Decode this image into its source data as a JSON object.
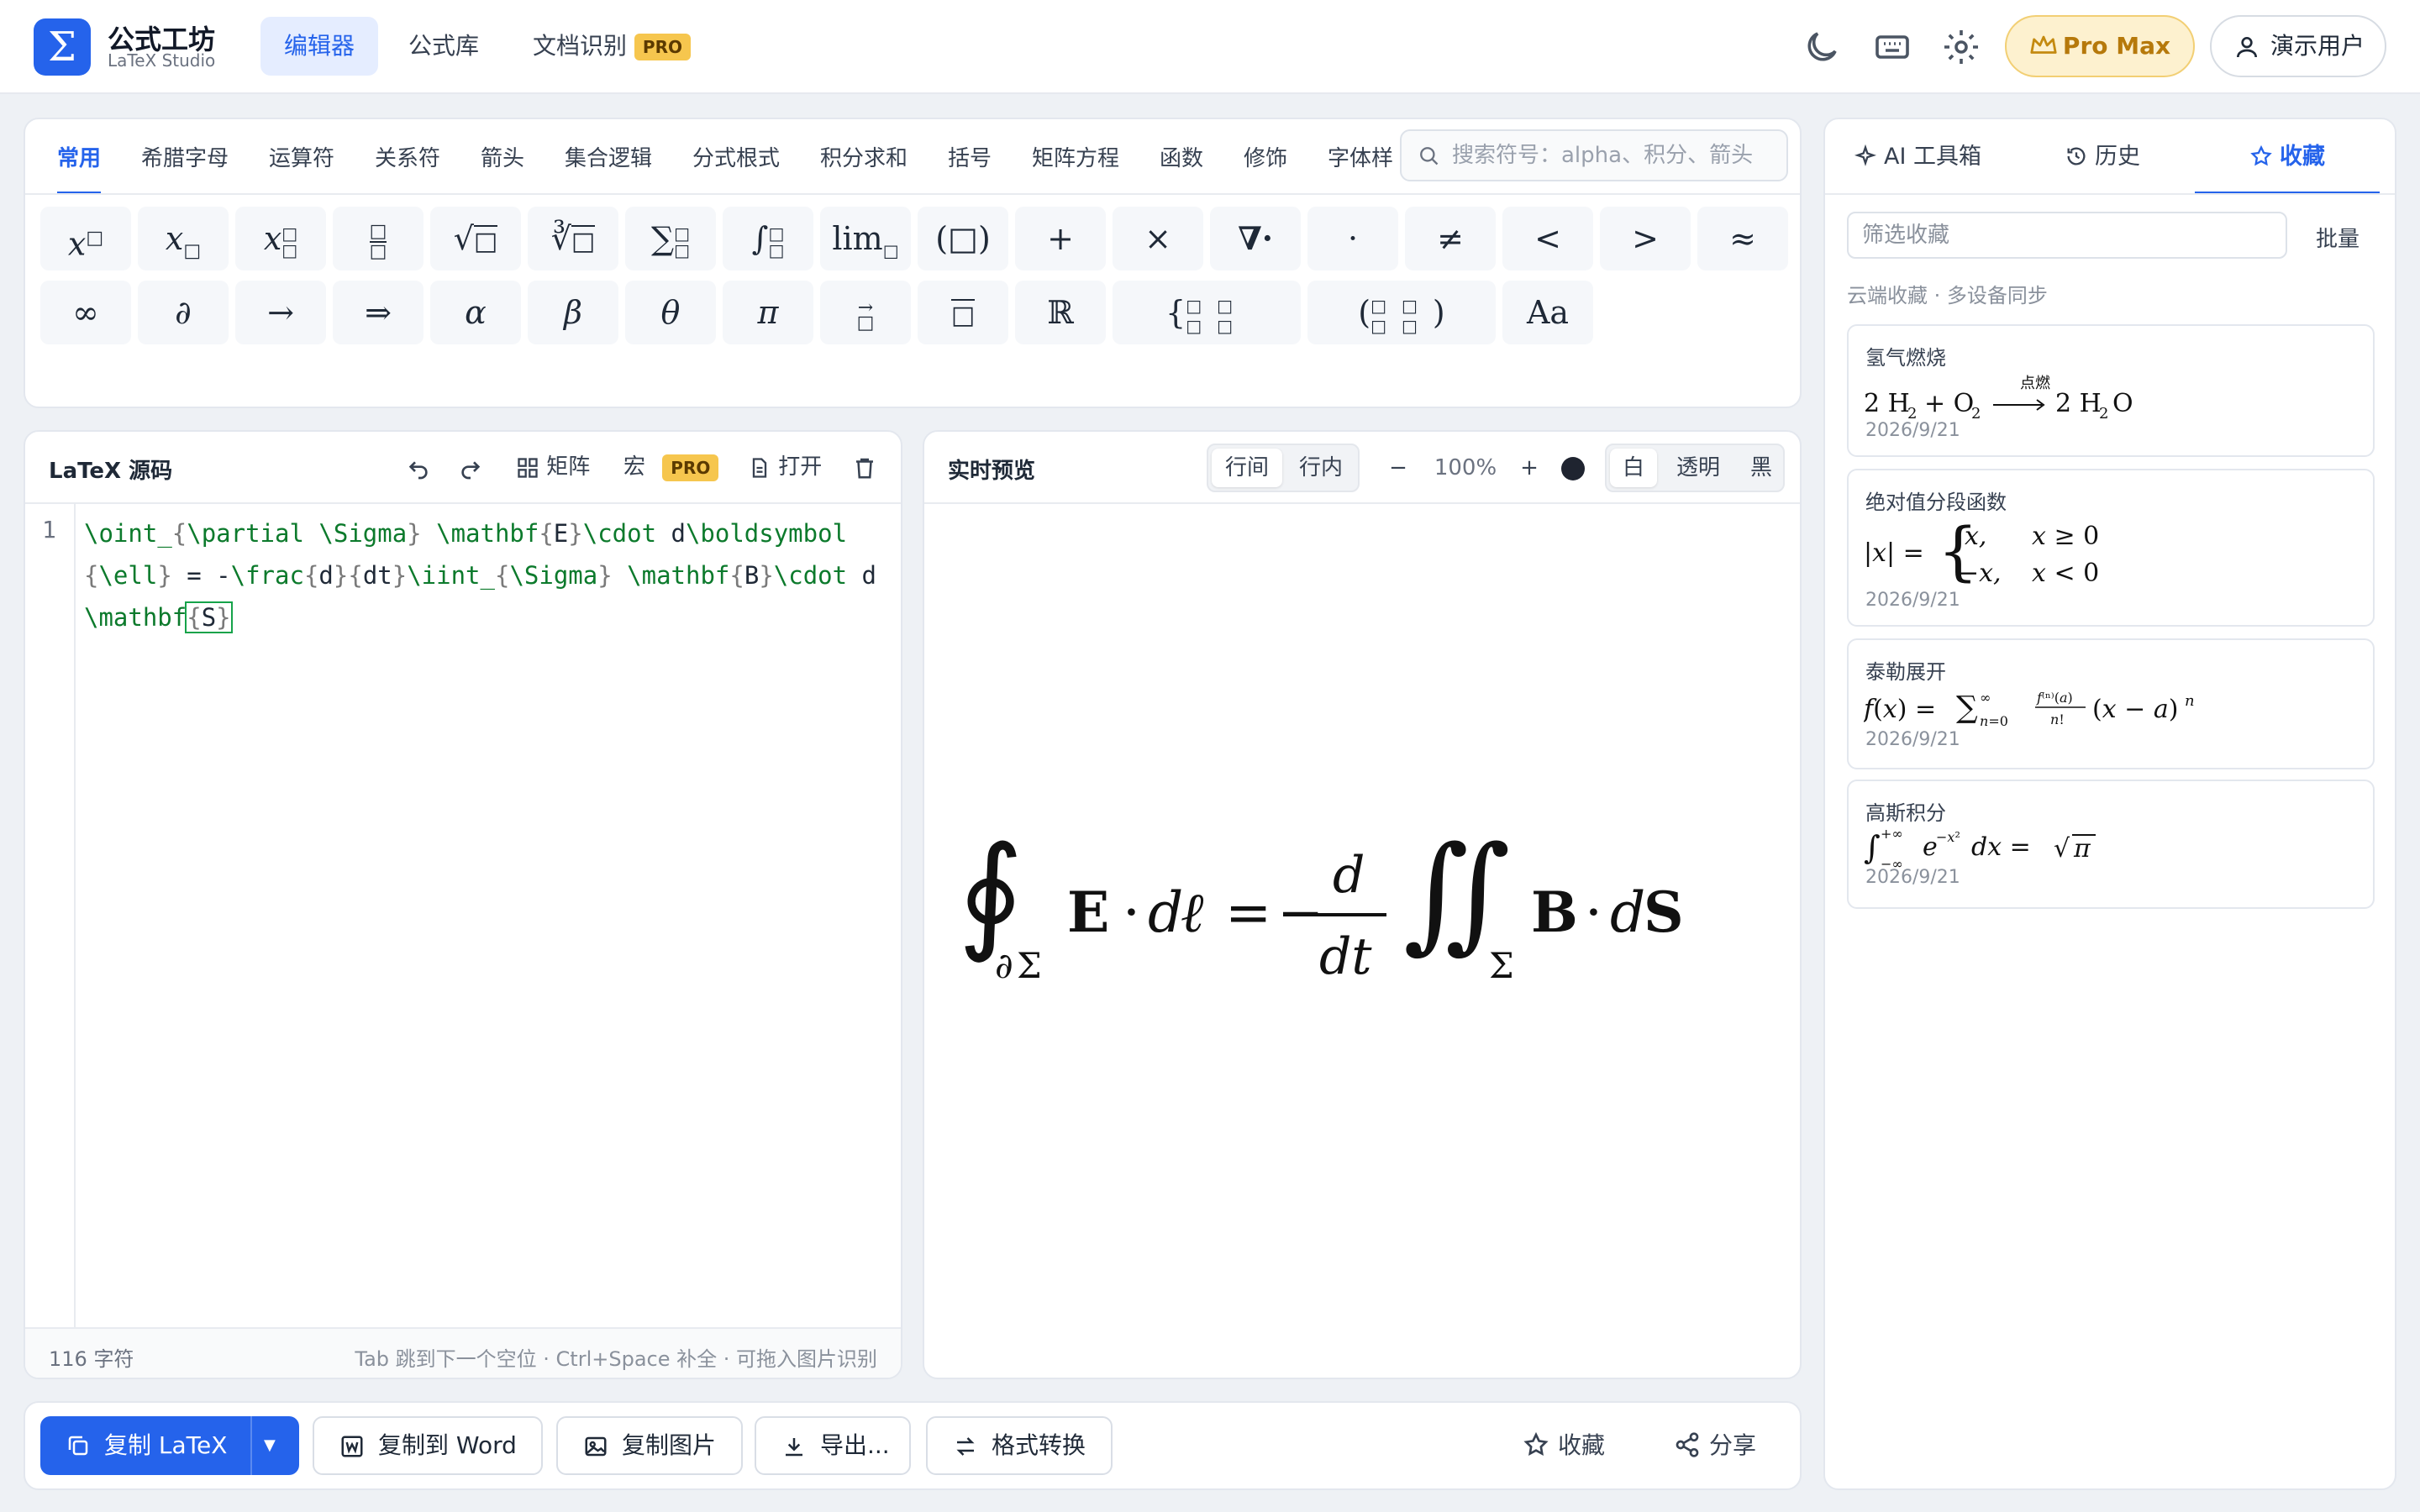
{
  "app": {
    "name": "公式工坊",
    "subtitle": "LaTeX Studio",
    "logo_glyph": "Σ",
    "accent": "#2563eb"
  },
  "nav": {
    "items": [
      {
        "label": "编辑器",
        "active": true
      },
      {
        "label": "公式库"
      },
      {
        "label": "文档识别",
        "badge": "PRO"
      }
    ]
  },
  "top_right": {
    "icons": [
      "moon-icon",
      "keyboard-icon",
      "gear-icon"
    ],
    "promax_label": "Pro Max",
    "user_label": "演示用户"
  },
  "palette": {
    "categories": [
      "常用",
      "希腊字母",
      "运算符",
      "关系符",
      "箭头",
      "集合逻辑",
      "分式根式",
      "积分求和",
      "括号",
      "矩阵方程",
      "函数",
      "修饰",
      "字体样"
    ],
    "active_category": "常用",
    "search_placeholder": "搜索符号：alpha、积分、箭头",
    "row1": [
      "x□",
      "x□",
      "x□□",
      "□/□",
      "√□",
      "∛□",
      "∑□□",
      "∫□□",
      "lim□",
      "(□)",
      "+",
      "×",
      "∇·",
      "·",
      "≠",
      "<",
      ">",
      "≈"
    ],
    "row2": [
      "∞",
      "∂",
      "→",
      "⇒",
      "α",
      "β",
      "θ",
      "π",
      "→□",
      "‾□",
      "ℝ",
      "{□□□□",
      "(□□□□)",
      "Aa"
    ]
  },
  "editor": {
    "title": "LaTeX 源码",
    "tools": {
      "matrix": "矩阵",
      "macro": "宏",
      "macro_badge": "PRO",
      "open": "打开"
    },
    "line_number": "1",
    "source": "\\oint_{\\partial \\Sigma} \\mathbf{E}\\cdot d\\boldsymbol{\\ell} = -\\frac{d}{dt}\\iint_{\\Sigma} \\mathbf{B}\\cdot d\\mathbf{S}",
    "char_count": "116 字符",
    "hint": "Tab 跳到下一个空位 · Ctrl+Space 补全 · 可拖入图片识别"
  },
  "preview": {
    "title": "实时预览",
    "display_modes": [
      "行间",
      "行内"
    ],
    "active_mode": "行间",
    "zoom": "100%",
    "backgrounds": [
      "白",
      "透明",
      "黑"
    ],
    "active_background": "白"
  },
  "actions": {
    "copy_latex": "复制 LaTeX",
    "copy_word": "复制到 Word",
    "copy_image": "复制图片",
    "export": "导出...",
    "convert": "格式转换",
    "favorite": "收藏",
    "share": "分享"
  },
  "side": {
    "tabs": [
      "AI 工具箱",
      "历史",
      "收藏"
    ],
    "active_tab": "收藏",
    "filter_placeholder": "筛选收藏",
    "bulk": "批量",
    "sync_note": "云端收藏 · 多设备同步",
    "favorites": [
      {
        "title": "氢气燃烧",
        "date": "2026/9/21",
        "arrow_label": "点燃"
      },
      {
        "title": "绝对值分段函数",
        "date": "2026/9/21"
      },
      {
        "title": "泰勒展开",
        "date": "2026/9/21"
      },
      {
        "title": "高斯积分",
        "date": "2026/9/21"
      }
    ]
  }
}
